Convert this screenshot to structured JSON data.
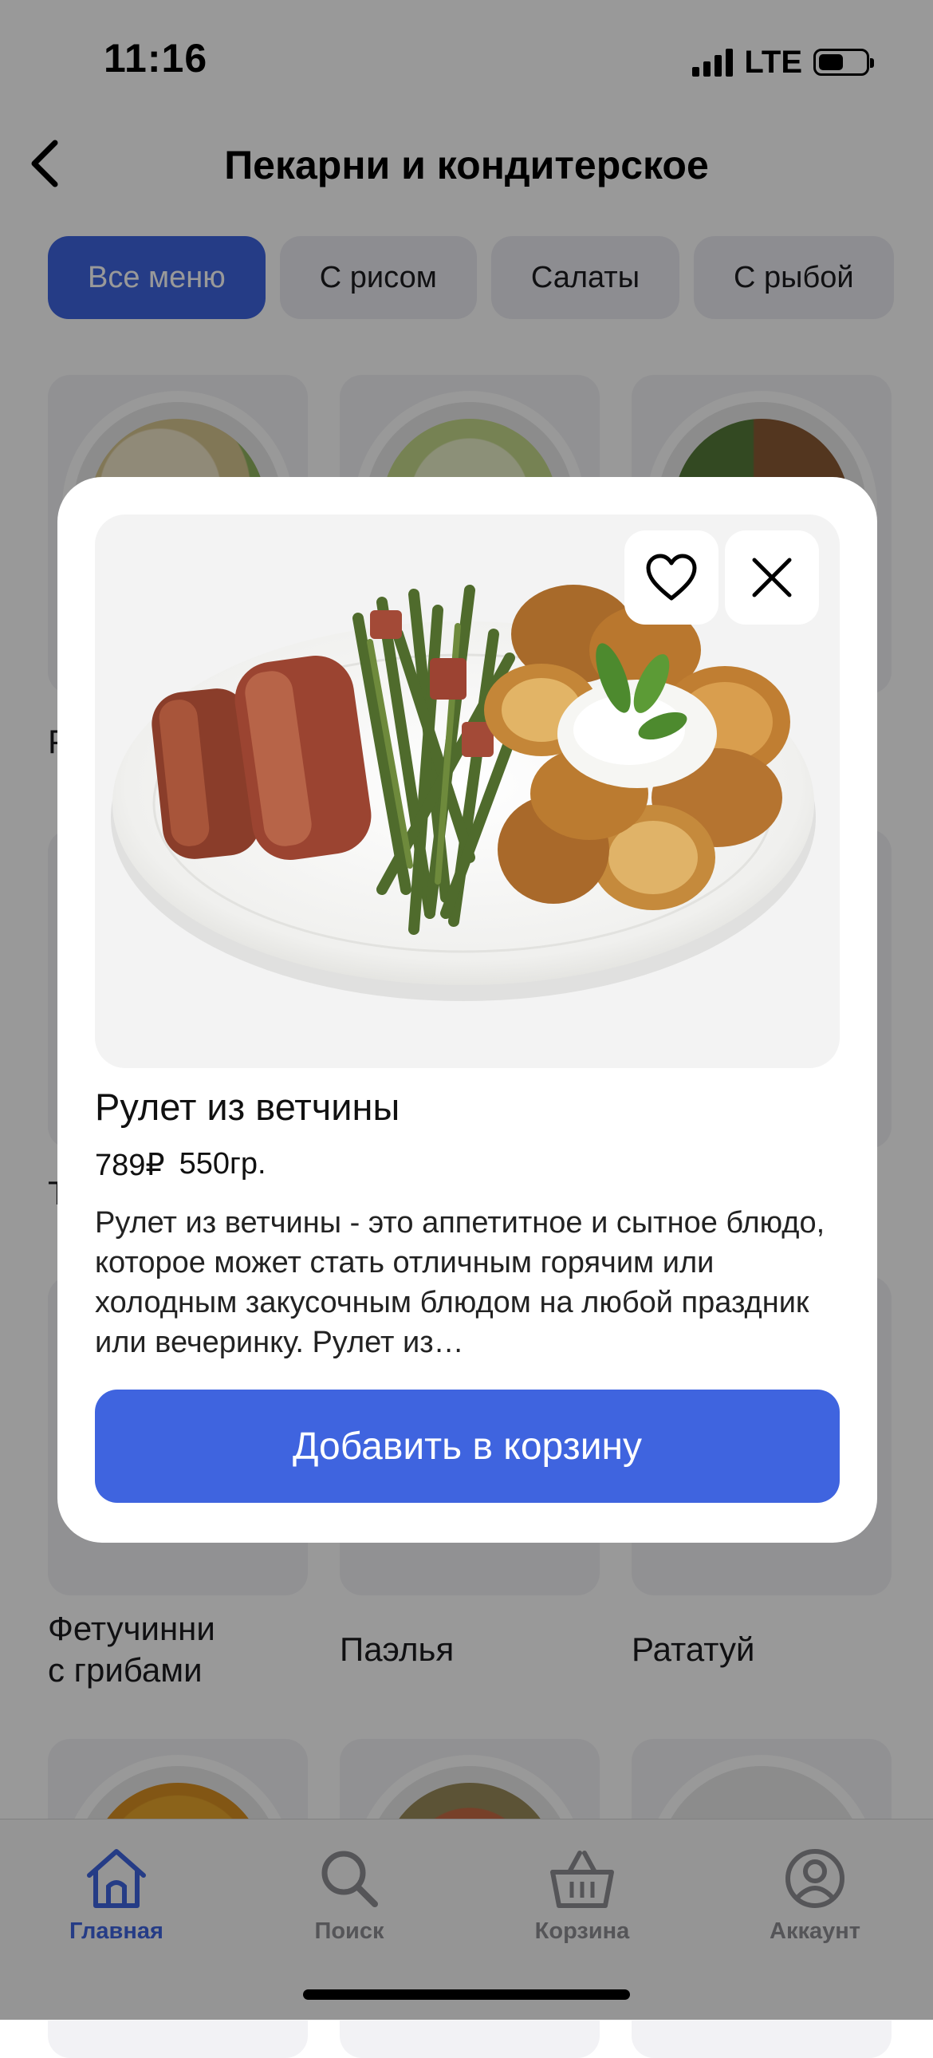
{
  "status_bar": {
    "time": "11:16",
    "network": "LTE"
  },
  "header": {
    "title": "Пекарни и кондитерское"
  },
  "categories": [
    {
      "label": "Все меню",
      "active": true
    },
    {
      "label": "С рисом",
      "active": false
    },
    {
      "label": "Салаты",
      "active": false
    },
    {
      "label": "С рыбой",
      "active": false
    }
  ],
  "grid_partial_labels": {
    "left_row2": "Р",
    "left_row3": "Т"
  },
  "grid_items_row3": [
    {
      "label_line1": "Фетучинни",
      "label_line2": "с грибами"
    },
    {
      "label_line1": "Паэлья",
      "label_line2": ""
    },
    {
      "label_line1": "Рататуй",
      "label_line2": ""
    }
  ],
  "modal": {
    "name": "Рулет из ветчины",
    "price": "789₽",
    "weight": "550гр.",
    "description": "Рулет из ветчины - это аппетитное и сытное блюдо, которое может стать отличным горячим или холодным закусочным блюдом на любой праздник или вечеринку. Рулет из…",
    "add_button": "Добавить в корзину",
    "favorite_icon": "heart-icon",
    "close_icon": "close-icon"
  },
  "tab_bar": [
    {
      "label": "Главная",
      "icon": "home-icon",
      "active": true
    },
    {
      "label": "Поиск",
      "icon": "search-icon",
      "active": false
    },
    {
      "label": "Корзина",
      "icon": "basket-icon",
      "active": false
    },
    {
      "label": "Аккаунт",
      "icon": "account-icon",
      "active": false
    }
  ],
  "colors": {
    "accent": "#3f64df",
    "inactive": "#8e8e93",
    "overlay": "rgba(0,0,0,0.40)"
  }
}
